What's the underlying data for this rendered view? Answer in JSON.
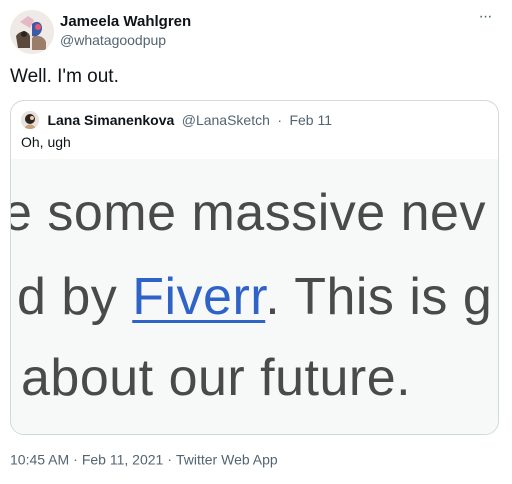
{
  "author": {
    "display_name": "Jameela Wahlgren",
    "handle": "@whatagoodpup"
  },
  "more_label": "···",
  "tweet_text": "Well. I'm out.",
  "quoted": {
    "display_name": "Lana Simanenkova",
    "handle": "@LanaSketch",
    "separator": "·",
    "date": "Feb 11",
    "text": "Oh, ugh",
    "media_text": {
      "line1": "e some massive nev",
      "line2_prefix": "d by ",
      "line2_link": "Fiverr",
      "line2_suffix": ". This is g",
      "line3": "about our future."
    }
  },
  "meta": {
    "time": "10:45 AM",
    "separator": "·",
    "date": "Feb 11, 2021",
    "app": "Twitter Web App"
  },
  "colors": {
    "accent_link": "#2f63c8",
    "secondary_text": "#536471",
    "border": "#cfd9de"
  }
}
